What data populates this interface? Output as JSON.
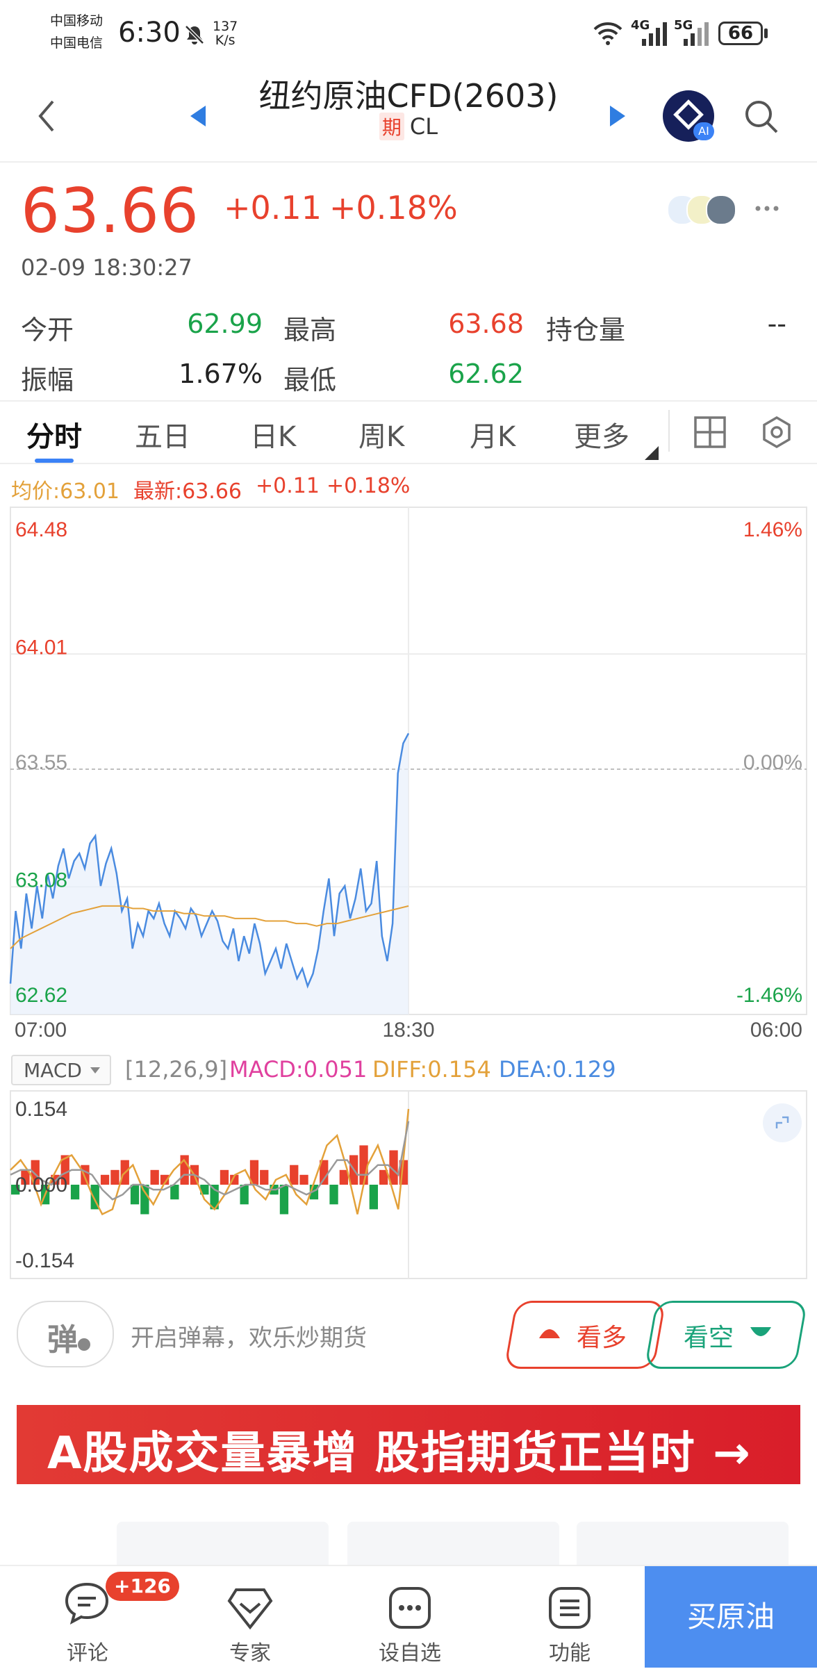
{
  "status_bar": {
    "carrier_1": "中国移动",
    "carrier_2": "中国电信",
    "time": "6:30",
    "net_speed_value": "137",
    "net_speed_unit": "K/s",
    "signal_4g": "4G",
    "signal_5g": "5G",
    "battery": "66"
  },
  "header": {
    "title": "纽约原油CFD(2603)",
    "futures_tag": "期",
    "symbol": "CL",
    "ai_badge": "AI"
  },
  "quote": {
    "last_price": "63.66",
    "change": "+0.11",
    "change_pct": "+0.18%",
    "timestamp": "02-09 18:30:27",
    "stats": [
      {
        "label": "今开",
        "value": "62.99"
      },
      {
        "label": "最高",
        "value": "63.68"
      },
      {
        "label": "持仓量",
        "value": "--"
      },
      {
        "label": "振幅",
        "value": "1.67%"
      },
      {
        "label": "最低",
        "value": "62.62"
      }
    ]
  },
  "tabs": [
    "分时",
    "五日",
    "日K",
    "周K",
    "月K",
    "更多"
  ],
  "chart_caption": {
    "avg": "均价:63.01",
    "latest": "最新:63.66",
    "change": "+0.11",
    "change_pct": "+0.18%"
  },
  "chart_data": [
    {
      "type": "line",
      "title": "",
      "xlabel": "",
      "ylabel": "",
      "x_ticks": [
        "07:00",
        "18:30",
        "06:00"
      ],
      "y_ticks_left": [
        "64.48",
        "64.01",
        "63.55",
        "63.08",
        "62.62"
      ],
      "y_ticks_right": [
        "1.46%",
        "0.00%",
        "-1.46%"
      ],
      "ylim": [
        62.62,
        64.48
      ],
      "reference_price": 63.55,
      "grid": true,
      "series": [
        {
          "name": "",
          "color": "#4a8be0",
          "values": [
            62.66,
            62.95,
            62.8,
            63.02,
            62.88,
            63.05,
            62.92,
            63.1,
            63.0,
            63.13,
            63.2,
            63.08,
            63.15,
            63.18,
            63.12,
            63.22,
            63.25,
            63.05,
            63.14,
            63.2,
            63.1,
            62.95,
            63.0,
            62.8,
            62.9,
            62.85,
            62.95,
            62.92,
            62.98,
            62.9,
            62.85,
            62.95,
            62.92,
            62.88,
            62.96,
            62.93,
            62.85,
            62.9,
            62.95,
            62.91,
            62.83,
            62.8,
            62.88,
            62.75,
            62.85,
            62.78,
            62.9,
            62.82,
            62.7,
            62.75,
            62.8,
            62.72,
            62.82,
            62.75,
            62.68,
            62.72,
            62.65,
            62.7,
            62.8,
            62.95,
            63.08,
            62.85,
            63.02,
            63.05,
            62.92,
            63.0,
            63.12,
            62.95,
            62.98,
            63.15,
            62.85,
            62.75,
            62.9,
            63.5,
            63.62,
            63.66
          ]
        },
        {
          "name": "",
          "color": "#e3a13a",
          "values": [
            62.8,
            62.84,
            62.86,
            62.88,
            62.9,
            62.92,
            62.94,
            62.95,
            62.96,
            62.97,
            62.97,
            62.97,
            62.96,
            62.96,
            62.95,
            62.95,
            62.95,
            62.94,
            62.94,
            62.93,
            62.93,
            62.93,
            62.92,
            62.92,
            62.92,
            62.91,
            62.91,
            62.91,
            62.9,
            62.9,
            62.89,
            62.9,
            62.9,
            62.91,
            62.92,
            62.93,
            62.94,
            62.95,
            62.96,
            62.97
          ]
        }
      ]
    },
    {
      "type": "bar",
      "title": "",
      "indicator": "MACD",
      "params": "[12,26,9]",
      "macd_label": "MACD:0.051",
      "diff_label": "DIFF:0.154",
      "dea_label": "DEA:0.129",
      "y_ticks": [
        "0.154",
        "0.000",
        "-0.154"
      ],
      "ylim": [
        -0.154,
        0.154
      ],
      "series": [
        {
          "name": "MACD",
          "values": [
            -0.02,
            0.03,
            0.05,
            -0.04,
            0.02,
            0.06,
            -0.03,
            0.04,
            -0.05,
            0.02,
            0.03,
            0.05,
            -0.04,
            -0.06,
            0.03,
            0.02,
            -0.03,
            0.06,
            0.04,
            -0.02,
            -0.05,
            0.03,
            0.02,
            -0.04,
            0.05,
            0.03,
            -0.02,
            -0.06,
            0.04,
            0.02,
            -0.03,
            0.05,
            -0.04,
            0.03,
            0.06,
            0.08,
            -0.05,
            0.03,
            0.07,
            0.05
          ]
        },
        {
          "name": "DIFF",
          "values": [
            0.03,
            0.05,
            0.02,
            -0.04,
            0.01,
            0.05,
            0.06,
            0.03,
            -0.02,
            -0.06,
            -0.05,
            0.02,
            0.04,
            -0.01,
            -0.04,
            0.0,
            0.03,
            0.05,
            0.02,
            -0.03,
            -0.05,
            -0.02,
            0.02,
            0.03,
            -0.01,
            -0.03,
            0.01,
            0.02,
            -0.02,
            -0.04,
            0.02,
            0.08,
            0.1,
            0.03,
            -0.06,
            0.04,
            0.08,
            0.02,
            -0.05,
            0.154
          ]
        },
        {
          "name": "DEA",
          "values": [
            0.02,
            0.03,
            0.03,
            0.01,
            0.0,
            0.02,
            0.03,
            0.03,
            0.02,
            -0.01,
            -0.03,
            -0.02,
            0.0,
            0.0,
            -0.01,
            -0.01,
            0.0,
            0.02,
            0.02,
            0.01,
            -0.01,
            -0.02,
            -0.01,
            0.0,
            0.0,
            -0.01,
            -0.01,
            0.0,
            -0.01,
            -0.02,
            -0.01,
            0.02,
            0.05,
            0.05,
            0.02,
            0.02,
            0.04,
            0.04,
            0.02,
            0.129
          ]
        }
      ]
    }
  ],
  "bottom": {
    "danmu_icon": "弹",
    "danmu_prompt": "开启弹幕，欢乐炒期货",
    "bullish": "看多",
    "bearish": "看空",
    "banner": "A股成交量暴增 股指期货正当时 →",
    "nav": [
      {
        "label": "评论",
        "badge": "+126"
      },
      {
        "label": "专家"
      },
      {
        "label": "设自选"
      },
      {
        "label": "功能"
      }
    ],
    "buy": "买原油"
  },
  "colors": {
    "up": "#e8412d",
    "down": "#1aa34a",
    "accent": "#3b82f6",
    "buy": "#4d8ef0"
  }
}
